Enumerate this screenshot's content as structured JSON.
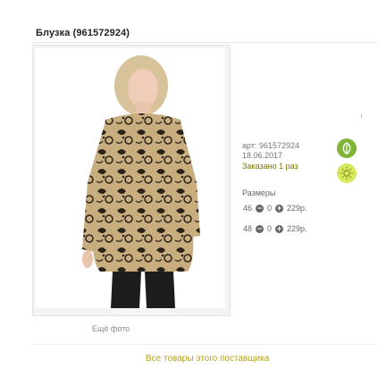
{
  "product": {
    "title": "Блузка (961572924)",
    "article": "арт: 961572924",
    "date": "18.06.2017",
    "ordered": "Заказано 1 раз",
    "more_photos": "Ещё фото",
    "all_goods_link": "Все товары этого поставщика"
  },
  "sizes": {
    "title": "Размеры",
    "rows": [
      {
        "size": "46",
        "qty": "0",
        "price": "229р."
      },
      {
        "size": "48",
        "qty": "0",
        "price": "229р."
      }
    ]
  },
  "icons": {
    "leaf": "leaf-icon",
    "sun": "sun-icon",
    "minus": "minus-icon",
    "plus": "plus-icon"
  },
  "colors": {
    "accent_link": "#b5a21e",
    "leaf_green": "#7fb437",
    "sun_yellow": "#d6e85c"
  }
}
